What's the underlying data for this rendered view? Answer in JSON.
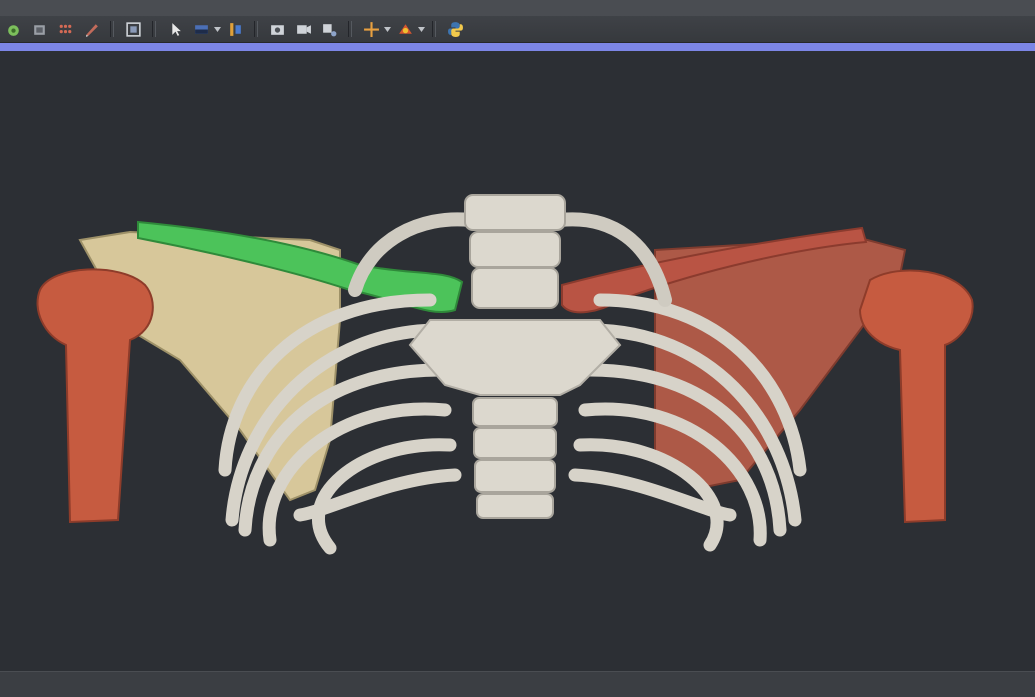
{
  "window": {
    "accent_color": "#7c86e6",
    "background_color": "#2c2f34"
  },
  "toolbar": {
    "buttons": [
      {
        "icon": "load-data-icon",
        "interactable": true
      },
      {
        "icon": "dicom-icon",
        "interactable": true
      },
      {
        "icon": "markups-icon",
        "interactable": true
      },
      {
        "icon": "edit-icon",
        "interactable": true
      },
      {
        "icon": "layout-icon",
        "interactable": true
      },
      {
        "icon": "select-pointer-icon",
        "interactable": true
      },
      {
        "icon": "window-level-icon",
        "interactable": true
      },
      {
        "icon": "crosshair-layout-icon",
        "interactable": true
      },
      {
        "icon": "screenshot-icon",
        "interactable": true
      },
      {
        "icon": "capture-icon",
        "interactable": true
      },
      {
        "icon": "record-icon",
        "interactable": true
      },
      {
        "icon": "crosshair-icon",
        "interactable": true
      },
      {
        "icon": "fiducial-icon",
        "interactable": true
      },
      {
        "icon": "python-icon",
        "interactable": true
      }
    ]
  },
  "scene": {
    "description_colors": {
      "bone": "#ddd9cf",
      "scapula_left": "#d7c79a",
      "clavicle_left": "#4cc35a",
      "humerus": "#b94a35",
      "scapula_right": "#ad5947",
      "clavicle_right": "#b95444"
    }
  }
}
